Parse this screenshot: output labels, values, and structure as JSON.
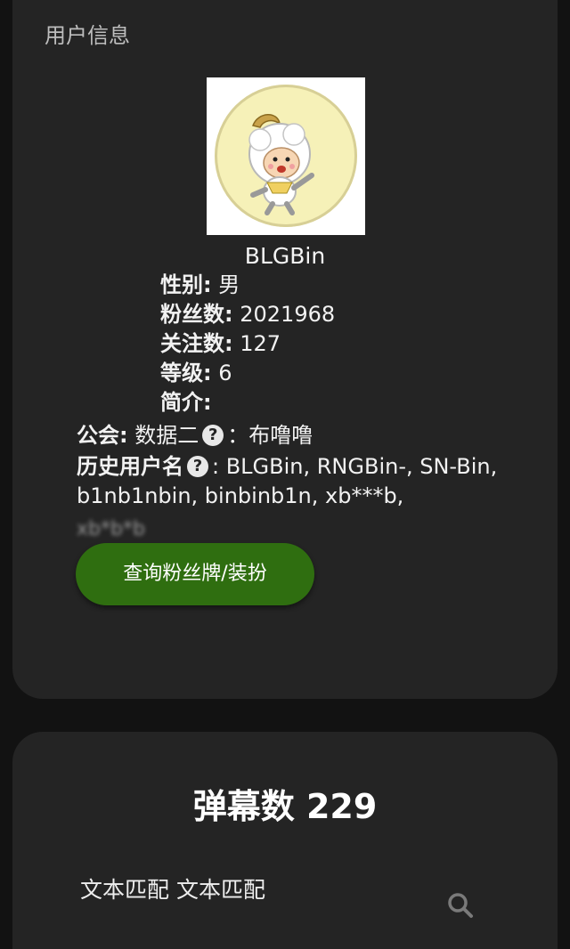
{
  "user_card": {
    "section_title": "用户信息",
    "username": "BLGBin",
    "fields": {
      "gender_label": "性别:",
      "gender_value": " 男",
      "fans_label": "粉丝数:",
      "fans_value": " 2021968",
      "following_label": "关注数:",
      "following_value": " 127",
      "level_label": "等级:",
      "level_value": " 6",
      "bio_label": "简介:",
      "bio_value": ""
    },
    "guild_label": "公会:",
    "guild_value_1": " 数据二",
    "guild_value_2": "：布噜噜",
    "history_label": "历史用户名",
    "history_value": ": BLGBin, RNGBin-, SN-Bin, b1nb1nbin, binbinb1n, xb***b,",
    "help_icon_glyph": "?",
    "blurred_text": "xb*b*b",
    "query_button_label": "查询粉丝牌/装扮"
  },
  "danmaku_card": {
    "title": "弹幕数 229",
    "filter_text": "文本匹配 文本匹配",
    "search_icon": "search-icon"
  },
  "colors": {
    "background": "#121212",
    "card": "#242424",
    "button": "#2f6e10"
  }
}
